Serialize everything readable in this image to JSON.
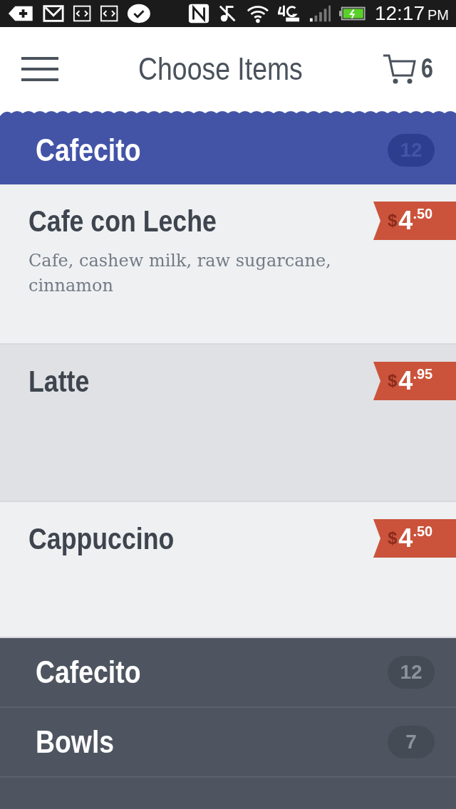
{
  "status_bar": {
    "time": "12:17",
    "meridiem": "PM"
  },
  "header": {
    "title": "Choose Items",
    "cart_count": "6"
  },
  "current_category": {
    "name": "Cafecito",
    "count": "12"
  },
  "items": [
    {
      "name": "Cafe con Leche",
      "description": "Cafe, cashew milk, raw sugarcane, cinnamon",
      "price": {
        "currency": "$",
        "whole": "4",
        "cents": ".50"
      },
      "selected": false
    },
    {
      "name": "Latte",
      "price": {
        "currency": "$",
        "whole": "4",
        "cents": ".95"
      },
      "selected": true
    },
    {
      "name": "Cappuccino",
      "price": {
        "currency": "$",
        "whole": "4",
        "cents": ".50"
      },
      "selected": false
    }
  ],
  "categories": [
    {
      "name": "Cafecito",
      "count": "12"
    },
    {
      "name": "Bowls",
      "count": "7"
    }
  ]
}
